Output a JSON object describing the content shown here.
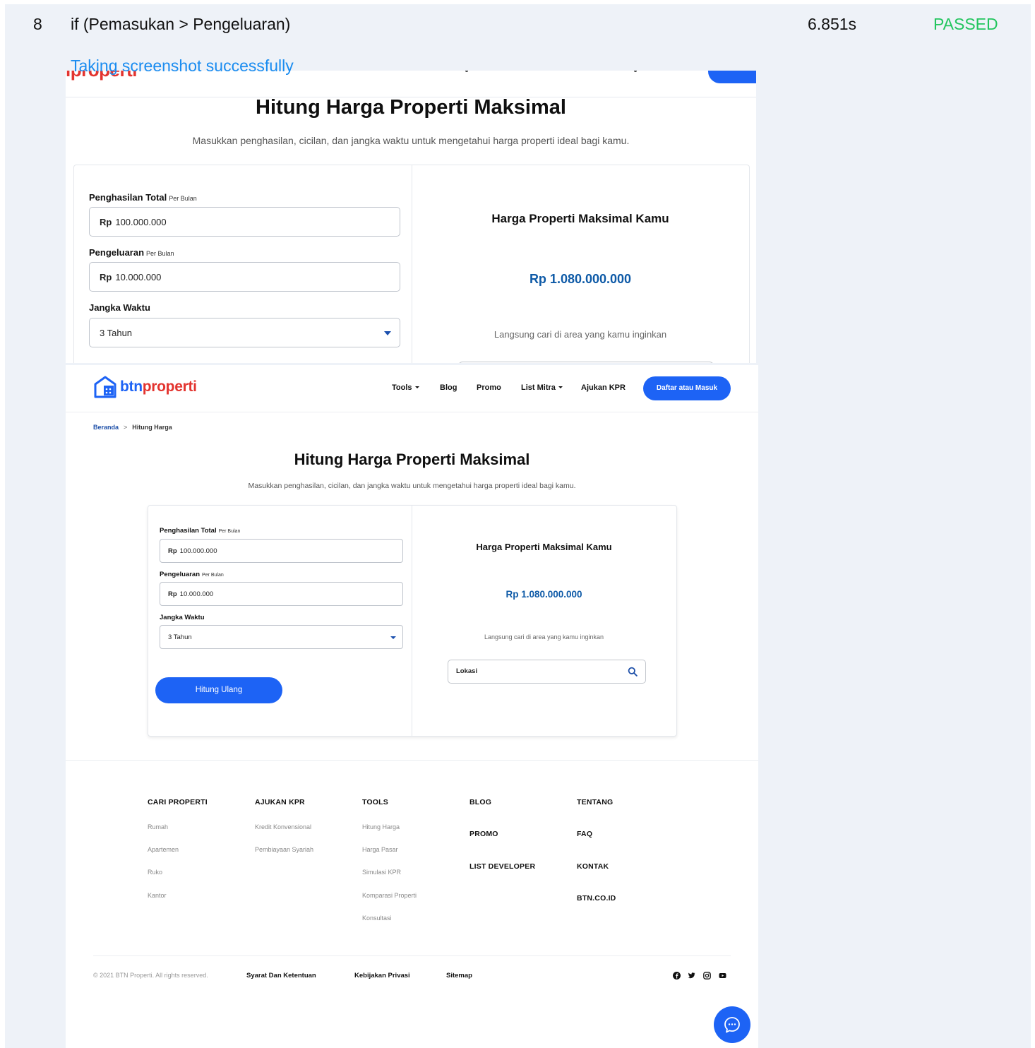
{
  "report": {
    "row_number": "8",
    "test_title": "if (Pemasukan > Pengeluaran)",
    "duration": "6.851s",
    "status": "PASSED",
    "log_message": "Taking screenshot successfully"
  },
  "shot1": {
    "logo_fragment": "iproperti",
    "title": "Hitung Harga Properti Maksimal",
    "subtitle": "Masukkan penghasilan, cicilan, dan jangka waktu untuk mengetahui harga properti ideal bagi kamu.",
    "income_label": "Penghasilan Total",
    "income_suffix": "Per Bulan",
    "income_prefix": "Rp",
    "income_value": "100.000.000",
    "expense_label": "Pengeluaran",
    "expense_suffix": "Per Bulan",
    "expense_prefix": "Rp",
    "expense_value": "10.000.000",
    "term_label": "Jangka Waktu",
    "term_value": "3 Tahun",
    "result_title": "Harga Properti Maksimal Kamu",
    "result_price": "Rp 1.080.000.000",
    "result_note": "Langsung cari di area yang kamu inginkan"
  },
  "shot2": {
    "logo": {
      "part1": "btn",
      "part2": "properti"
    },
    "nav": {
      "tools": "Tools",
      "blog": "Blog",
      "promo": "Promo",
      "list_mitra": "List Mitra",
      "ajukan_kpr": "Ajukan KPR",
      "cta": "Daftar atau Masuk"
    },
    "breadcrumb": {
      "home": "Beranda",
      "current": "Hitung Harga"
    },
    "title": "Hitung Harga Properti Maksimal",
    "subtitle": "Masukkan penghasilan, cicilan, dan jangka waktu untuk mengetahui harga properti ideal bagi kamu.",
    "form": {
      "income_label": "Penghasilan Total",
      "income_suffix": "Per Bulan",
      "income_prefix": "Rp",
      "income_value": "100.000.000",
      "expense_label": "Pengeluaran",
      "expense_suffix": "Per Bulan",
      "expense_prefix": "Rp",
      "expense_value": "10.000.000",
      "term_label": "Jangka Waktu",
      "term_value": "3 Tahun",
      "recalc_button": "Hitung Ulang"
    },
    "result": {
      "title": "Harga Properti Maksimal Kamu",
      "price": "Rp 1.080.000.000",
      "note": "Langsung cari di area yang kamu inginkan",
      "location_placeholder": "Lokasi"
    },
    "footer": {
      "cari_properti": {
        "heading": "CARI PROPERTI",
        "links": [
          "Rumah",
          "Apartemen",
          "Ruko",
          "Kantor"
        ]
      },
      "ajukan_kpr": {
        "heading": "AJUKAN KPR",
        "links": [
          "Kredit Konvensional",
          "Pembiayaan Syariah"
        ]
      },
      "tools": {
        "heading": "TOOLS",
        "links": [
          "Hitung Harga",
          "Harga Pasar",
          "Simulasi KPR",
          "Komparasi Properti",
          "Konsultasi"
        ]
      },
      "col4": [
        "BLOG",
        "PROMO",
        "LIST DEVELOPER"
      ],
      "col5": [
        "TENTANG",
        "FAQ",
        "KONTAK",
        "BTN.CO.ID"
      ],
      "copyright": "© 2021 BTN Properti. All rights reserved.",
      "terms": "Syarat Dan Ketentuan",
      "privacy": "Kebijakan Privasi",
      "sitemap": "Sitemap"
    }
  },
  "colors": {
    "primary": "#1d63f5",
    "brand_red": "#e3342f",
    "price": "#0e5aa7",
    "passed": "#22c55e",
    "log": "#1a8cf0"
  }
}
